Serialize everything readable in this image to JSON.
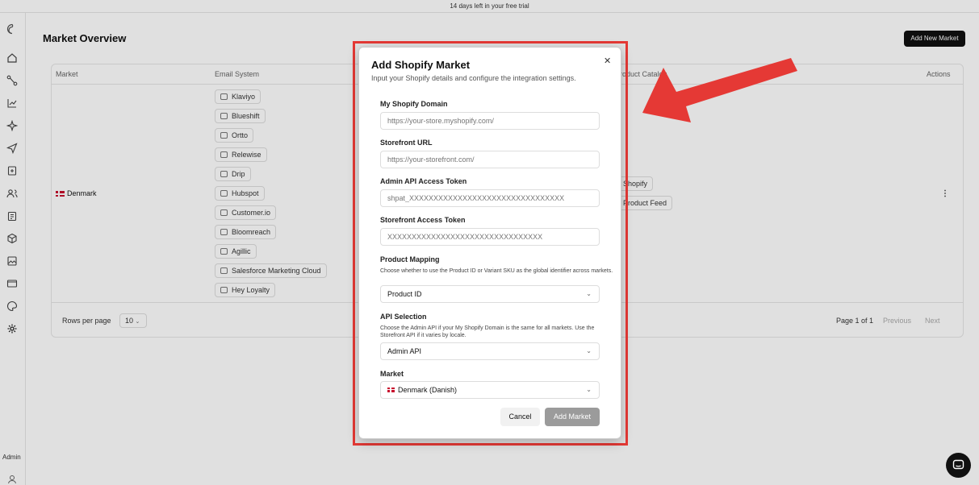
{
  "banner": {
    "text": "14 days left in your free trial"
  },
  "sidebar": {
    "icons": [
      "logo-icon",
      "home-icon",
      "route-icon",
      "chart-icon",
      "sparkle-icon",
      "send-icon",
      "export-icon",
      "users-icon",
      "clipboard-icon",
      "box-icon",
      "image-icon",
      "mail-icon",
      "palette-icon",
      "settings-icon"
    ],
    "user_label": "Admin"
  },
  "page": {
    "title": "Market Overview",
    "add_button": "Add New Market"
  },
  "table": {
    "headers": {
      "market": "Market",
      "email": "Email System",
      "catalog": "Product Catalog",
      "actions": "Actions"
    },
    "row": {
      "market": "Denmark",
      "email_systems": [
        "Klaviyo",
        "Blueshift",
        "Ortto",
        "Relewise",
        "Drip",
        "Hubspot",
        "Customer.io",
        "Bloomreach",
        "Agillic",
        "Salesforce Marketing Cloud",
        "Hey Loyalty"
      ],
      "catalogs": [
        "Shopify",
        "Product Feed"
      ]
    },
    "footer": {
      "rows_per_page_label": "Rows per page",
      "rows_per_page_value": "10",
      "page_info": "Page 1 of 1",
      "previous": "Previous",
      "next": "Next"
    }
  },
  "modal": {
    "title": "Add Shopify Market",
    "subtitle": "Input your Shopify details and configure the integration settings.",
    "fields": {
      "domain": {
        "label": "My Shopify Domain",
        "placeholder": "https://your-store.myshopify.com/"
      },
      "storefront_url": {
        "label": "Storefront URL",
        "placeholder": "https://your-storefront.com/"
      },
      "admin_token": {
        "label": "Admin API Access Token",
        "placeholder": "shpat_XXXXXXXXXXXXXXXXXXXXXXXXXXXXXXXX"
      },
      "storefront_token": {
        "label": "Storefront Access Token",
        "placeholder": "XXXXXXXXXXXXXXXXXXXXXXXXXXXXXXXX"
      },
      "product_mapping": {
        "label": "Product Mapping",
        "help": "Choose whether to use the Product ID or Variant SKU as the global identifier across markets.",
        "value": "Product ID"
      },
      "api_selection": {
        "label": "API Selection",
        "help": "Choose the Admin API if your My Shopify Domain is the same for all markets. Use the Storefront API if it varies by locale.",
        "value": "Admin API"
      },
      "market": {
        "label": "Market",
        "value": "Denmark (Danish)"
      }
    },
    "cancel": "Cancel",
    "submit": "Add Market"
  },
  "colors": {
    "highlight": "#e53935",
    "primary": "#111111",
    "disabled": "#9b9b9b"
  }
}
